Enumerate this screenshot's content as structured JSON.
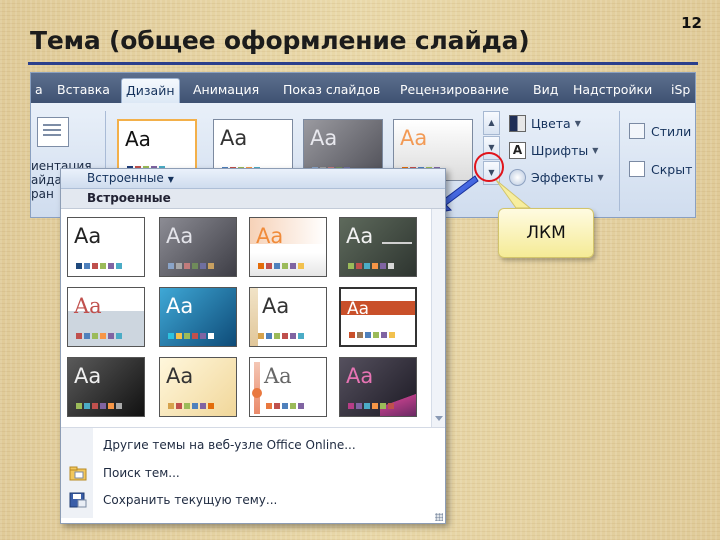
{
  "slide": {
    "title": "Тема (общее оформление слайда)",
    "number": "12"
  },
  "ribbon": {
    "tabs": [
      {
        "label": "а"
      },
      {
        "label": "Вставка"
      },
      {
        "label": "Дизайн"
      },
      {
        "label": "Анимация"
      },
      {
        "label": "Показ слайдов"
      },
      {
        "label": "Рецензирование"
      },
      {
        "label": "Вид"
      },
      {
        "label": "Надстройки"
      },
      {
        "label": "iSp"
      }
    ],
    "orientation_label_1": "иентация",
    "orientation_label_2": "айда",
    "orientation_label_3": "ран",
    "thumb_text": "Aa",
    "commands": {
      "colors": "Цвета",
      "fonts": "Шрифты",
      "effects": "Эффекты",
      "fonts_icon_letter": "A"
    },
    "right_commands": {
      "styles": "Стили",
      "hide": "Скрыт"
    }
  },
  "callout": {
    "text": "ЛКМ"
  },
  "gallery": {
    "header": "Встроенные",
    "subheader": "Встроенные",
    "thumb_text": "Aa",
    "menu": {
      "online": "Другие темы на веб-узле Office Online...",
      "search": "Поиск тем...",
      "save": "Сохранить текущую тему..."
    }
  },
  "colors": {
    "title_rule": "#2b3f8c",
    "ribbon_tab_bg": "#4a5d7e",
    "selected_border": "#f3b04a",
    "highlight_circle": "#e0141b",
    "arrow": "#1f4fd8",
    "callout_bg": "#f8efa4"
  }
}
